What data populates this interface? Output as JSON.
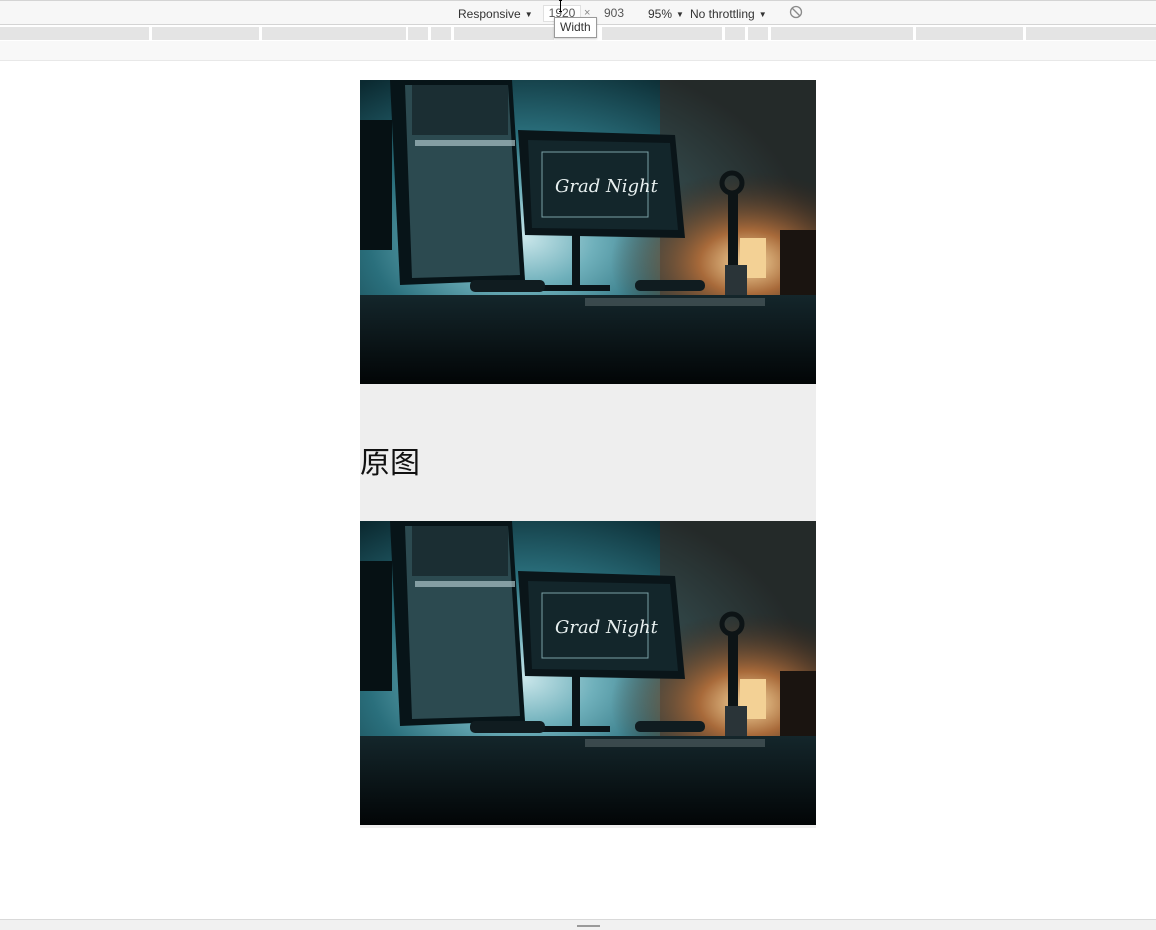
{
  "toolbar": {
    "device": "Responsive",
    "width": "1920",
    "height": "903",
    "separator": "×",
    "zoom": "95%",
    "throttling": "No throttling",
    "rotate_icon": "rotate-disabled-icon"
  },
  "tooltip": {
    "text": "Width"
  },
  "page": {
    "caption": "原图",
    "photo_text": "Grad Night"
  },
  "colors": {
    "toolbar_bg": "#f7f7f7",
    "caption_bg": "#eeeeee",
    "photo_bg": "#061014"
  }
}
